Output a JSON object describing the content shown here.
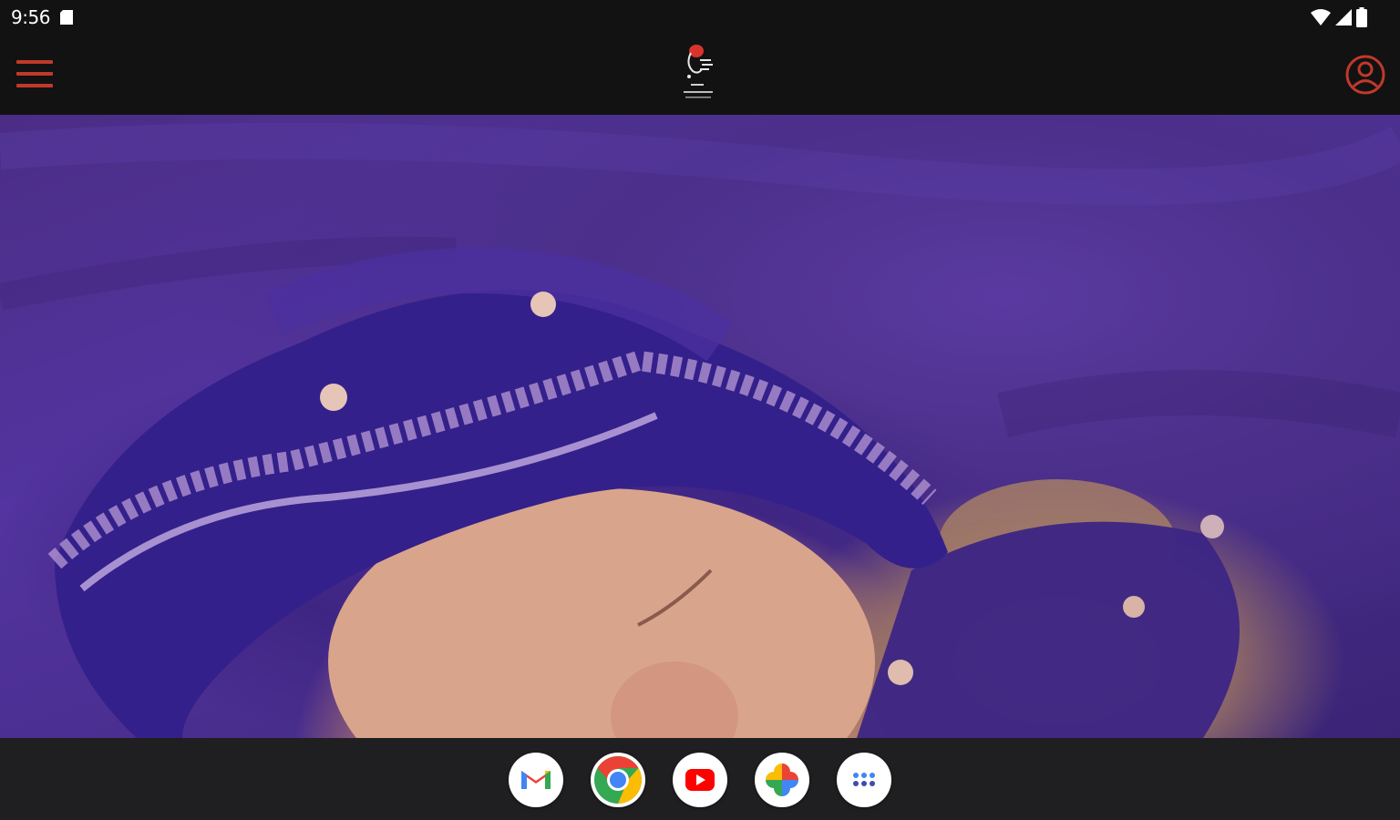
{
  "status_bar": {
    "time": "9:56",
    "icons": [
      "sd-card-icon",
      "wifi-icon",
      "cellular-signal-icon",
      "battery-icon"
    ]
  },
  "app_bar": {
    "menu_icon": "hamburger-menu-icon",
    "logo": "studio-logo",
    "account_icon": "account-circle-icon",
    "accent_color": "#c0392b"
  },
  "hero": {
    "content": "photo-newborn-purple-bonnet"
  },
  "dock": {
    "apps": [
      "gmail-icon",
      "chrome-icon",
      "youtube-icon",
      "google-photos-icon",
      "app-drawer-icon"
    ]
  }
}
